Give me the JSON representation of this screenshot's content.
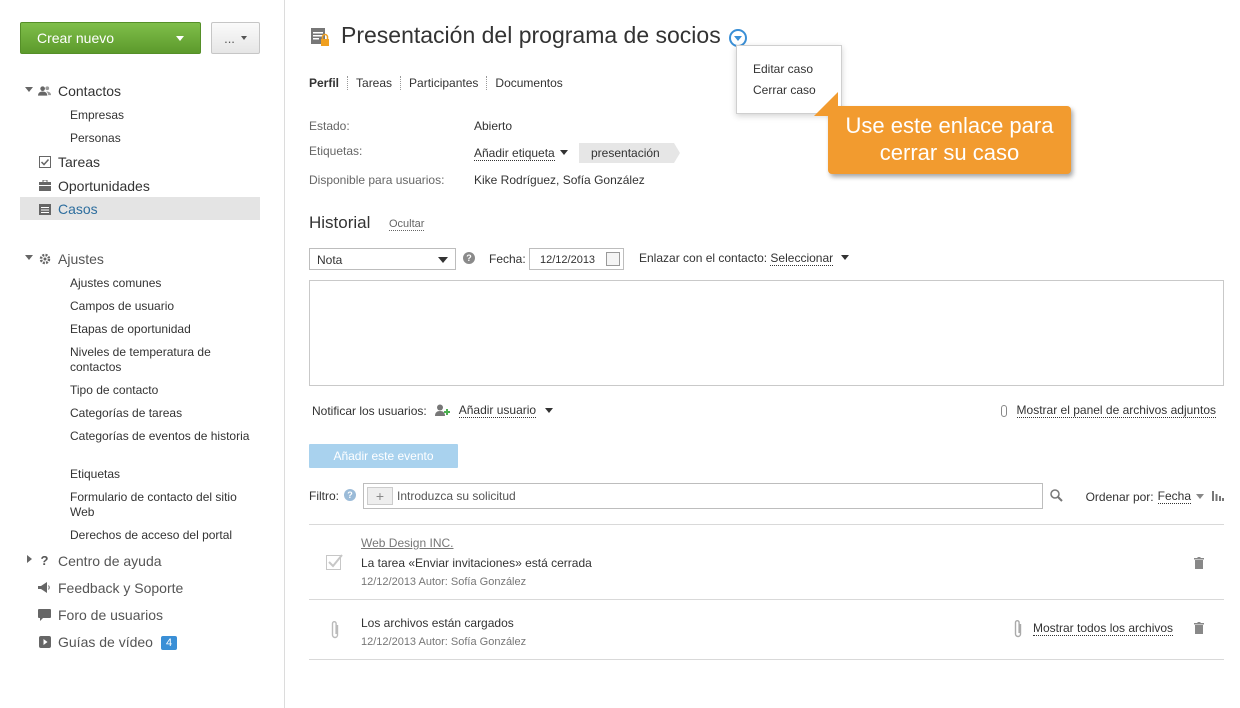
{
  "sidebar": {
    "create_label": "Crear nuevo",
    "more_label": "...",
    "contacts": {
      "label": "Contactos",
      "items": [
        "Empresas",
        "Personas"
      ]
    },
    "tasks": "Tareas",
    "opportunities": "Oportunidades",
    "cases": "Casos",
    "settings": {
      "label": "Ajustes",
      "items": [
        "Ajustes comunes",
        "Campos de usuario",
        "Etapas de oportunidad",
        "Niveles de temperatura de contactos",
        "Tipo de contacto",
        "Categorías de tareas",
        "Categorías de eventos de historia",
        "Etiquetas",
        "Formulario de contacto del sitio Web",
        "Derechos de acceso del portal"
      ]
    },
    "help_center": "Centro de ayuda",
    "feedback": "Feedback y Soporte",
    "forum": "Foro de usuarios",
    "videos": {
      "label": "Guías de vídeo",
      "badge": "4"
    }
  },
  "main": {
    "title": "Presentación del programa de socios",
    "menu": {
      "edit": "Editar caso",
      "close": "Cerrar caso"
    },
    "callout": {
      "line1": "Use este enlace para",
      "line2": "cerrar su caso"
    },
    "tabs": [
      "Perfil",
      "Tareas",
      "Participantes",
      "Documentos"
    ],
    "fields": {
      "status_label": "Estado:",
      "status_value": "Abierto",
      "tags_label": "Etiquetas:",
      "add_tag": "Añadir etiqueta",
      "tag": "presentación",
      "available_label": "Disponible para usuarios:",
      "available_value": "Kike Rodríguez,  Sofía González"
    },
    "history": {
      "title": "Historial",
      "hide": "Ocultar",
      "type_value": "Nota",
      "date_label": "Fecha:",
      "date_value": "12/12/2013",
      "link_contact_label": "Enlazar con el contacto:",
      "link_contact_value": "Seleccionar",
      "notify_label": "Notificar los usuarios:",
      "add_user": "Añadir usuario",
      "attachments": "Mostrar el panel de archivos adjuntos",
      "add_event": "Añadir este evento",
      "filter_label": "Filtro:",
      "filter_placeholder": "Introduzca su solicitud",
      "order_label": "Ordenar por:",
      "order_value": "Fecha"
    },
    "events": [
      {
        "link": "Web Design INC.",
        "text": "La tarea «Enviar invitaciones» está cerrada",
        "meta": "12/12/2013 Autor: Sofía González"
      },
      {
        "text": "Los archivos están cargados",
        "meta": "12/12/2013 Autor: Sofía González",
        "action": "Mostrar todos los archivos"
      }
    ]
  }
}
